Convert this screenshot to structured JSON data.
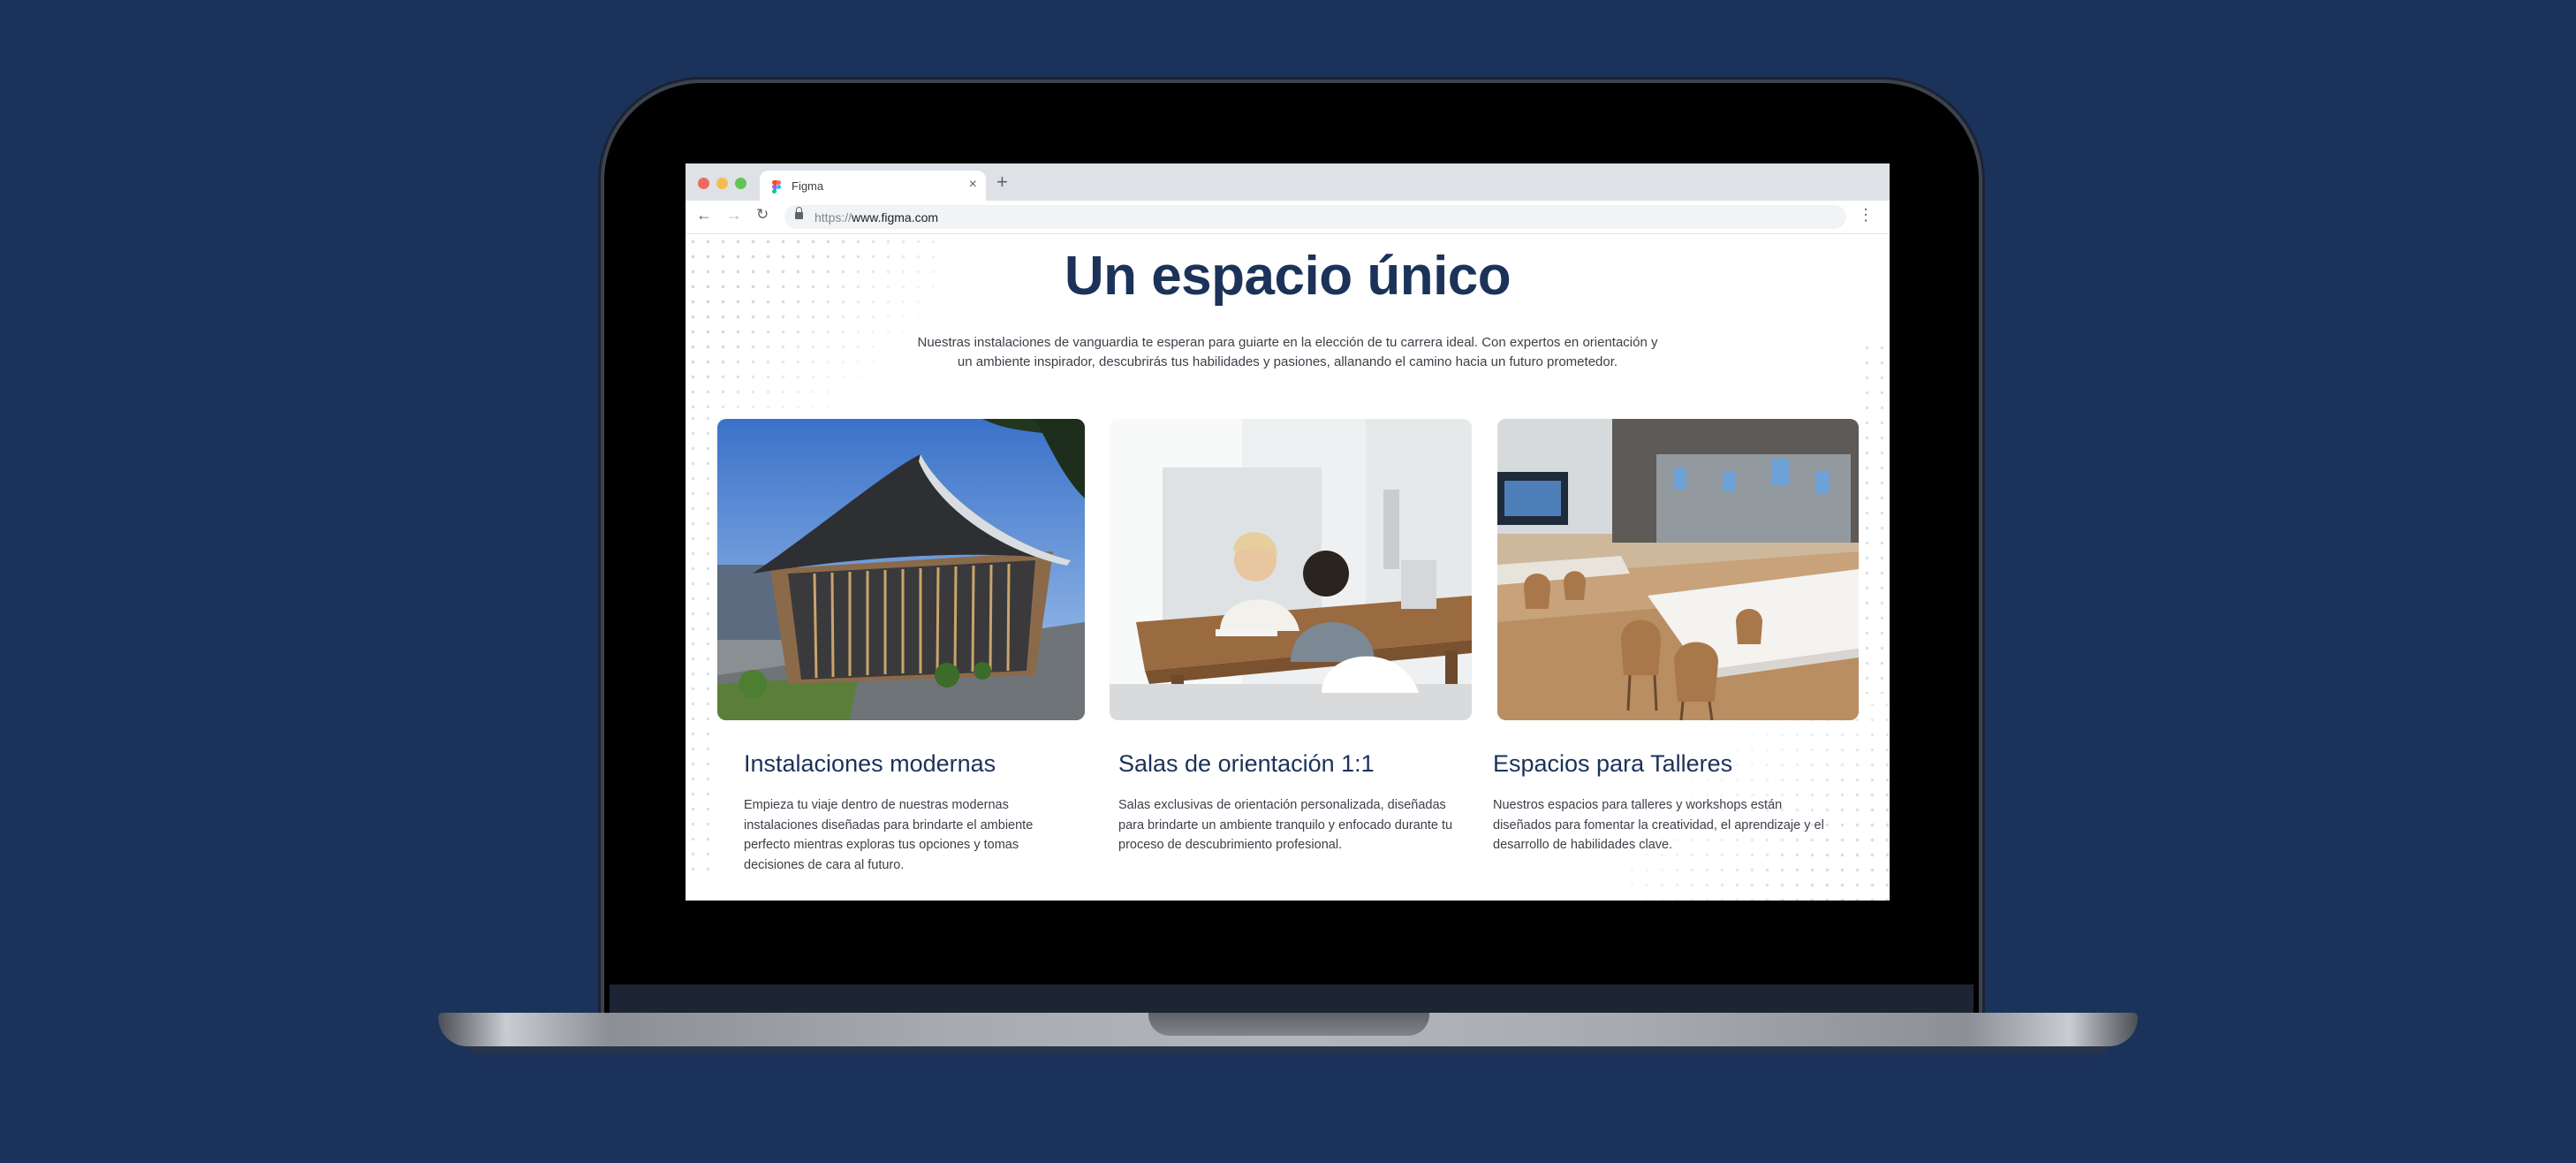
{
  "browser": {
    "tab_title": "Figma",
    "tab_close": "×",
    "new_tab": "+",
    "url_scheme": "https://",
    "url_host": "www.figma.com",
    "nav": {
      "back": "←",
      "forward": "→",
      "reload": "↻",
      "menu": "⋮"
    }
  },
  "hero": {
    "title": "Un espacio único",
    "subtitle_line1": "Nuestras instalaciones de vanguardia te esperan para guiarte en la elección de tu carrera ideal. Con expertos en orientación y",
    "subtitle_line2": "un ambiente inspirador, descubrirás tus habilidades y pasiones, allanando el camino hacia un futuro prometedor."
  },
  "cards": [
    {
      "title": "Instalaciones modernas",
      "description": "Empieza tu viaje dentro de nuestras modernas instalaciones diseñadas para brindarte el ambiente perfecto mientras exploras tus opciones y tomas decisiones de cara al futuro."
    },
    {
      "title": "Salas de orientación 1:1",
      "description": "Salas exclusivas de orientación personalizada, diseñadas para brindarte un ambiente tranquilo y enfocado durante tu proceso de descubrimiento profesional."
    },
    {
      "title": "Espacios para Talleres",
      "description": "Nuestros espacios para talleres y workshops están diseñados para fomentar la creatividad, el aprendizaje y el desarrollo de habilidades clave."
    }
  ],
  "colors": {
    "background": "#1b335b",
    "heading": "#1b3259",
    "body_text": "#3b3f47"
  }
}
